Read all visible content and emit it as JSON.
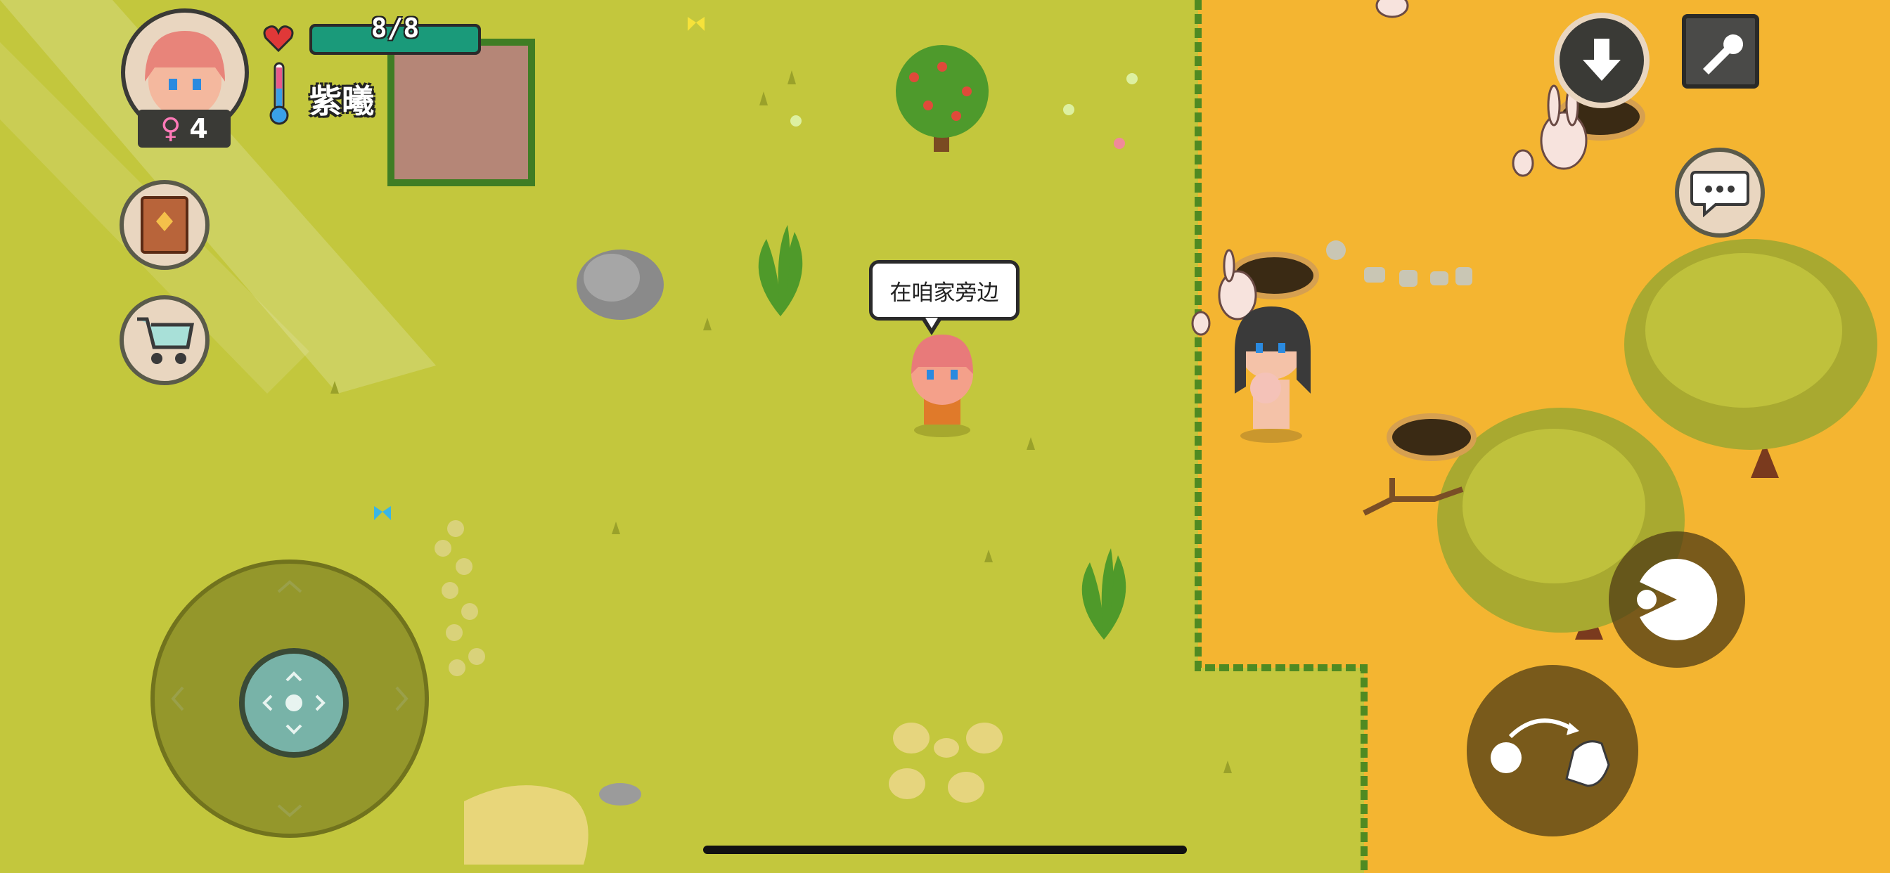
{
  "player": {
    "name": "紫曦",
    "health_text": "8/8",
    "health_fraction": 1.0,
    "age": "4",
    "gender_symbol": "♀",
    "temperature_fraction": 0.3
  },
  "speech_bubble": {
    "text": "在咱家旁边"
  },
  "hud": {
    "left_buttons": [
      "recipe-book-icon",
      "shopping-cart-icon"
    ],
    "right_buttons": [
      "drop-arrow-icon",
      "wrench-icon",
      "chat-icon"
    ],
    "action_buttons": [
      "eat-pacman-icon",
      "throw-hand-icon"
    ]
  },
  "colors": {
    "grass": "#c3c73d",
    "desert": "#f4b531",
    "hp_bar": "#1a9a7a",
    "heart": "#e03838"
  }
}
